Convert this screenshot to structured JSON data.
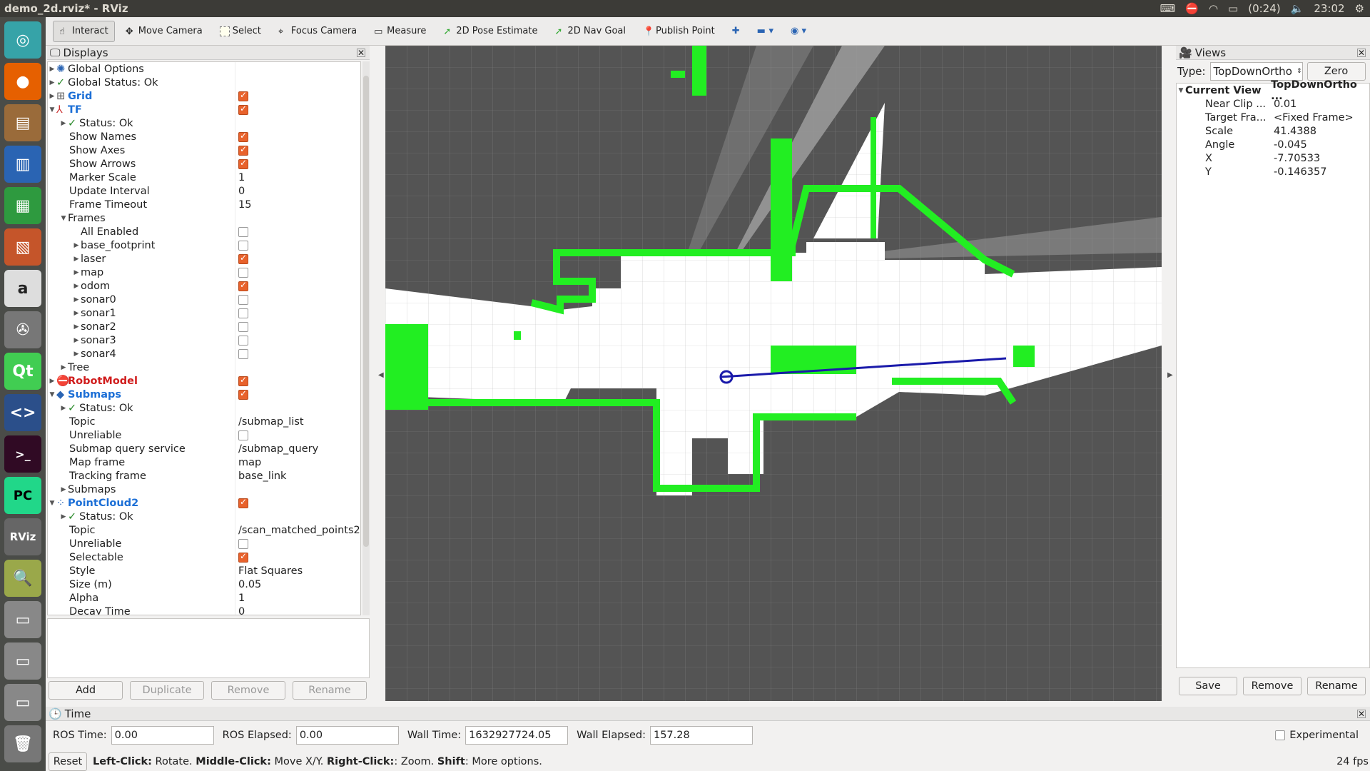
{
  "window": {
    "title": "demo_2d.rviz* - RViz",
    "battery": "(0:24)",
    "clock": "23:02"
  },
  "toolbar": {
    "interact": "Interact",
    "move_camera": "Move Camera",
    "select": "Select",
    "focus_camera": "Focus Camera",
    "measure": "Measure",
    "pose_estimate": "2D Pose Estimate",
    "nav_goal": "2D Nav Goal",
    "publish_point": "Publish Point"
  },
  "displays": {
    "title": "Displays",
    "rows": [
      {
        "label": "Global Options",
        "value": ""
      },
      {
        "label": "Global Status: Ok",
        "value": ""
      },
      {
        "label": "Grid",
        "value": ""
      },
      {
        "label": "TF",
        "value": ""
      },
      {
        "label": "Status: Ok",
        "value": ""
      },
      {
        "label": "Show Names",
        "value": ""
      },
      {
        "label": "Show Axes",
        "value": ""
      },
      {
        "label": "Show Arrows",
        "value": ""
      },
      {
        "label": "Marker Scale",
        "value": "1"
      },
      {
        "label": "Update Interval",
        "value": "0"
      },
      {
        "label": "Frame Timeout",
        "value": "15"
      },
      {
        "label": "Frames",
        "value": ""
      },
      {
        "label": "All Enabled",
        "value": ""
      },
      {
        "label": "base_footprint",
        "value": ""
      },
      {
        "label": "laser",
        "value": ""
      },
      {
        "label": "map",
        "value": ""
      },
      {
        "label": "odom",
        "value": ""
      },
      {
        "label": "sonar0",
        "value": ""
      },
      {
        "label": "sonar1",
        "value": ""
      },
      {
        "label": "sonar2",
        "value": ""
      },
      {
        "label": "sonar3",
        "value": ""
      },
      {
        "label": "sonar4",
        "value": ""
      },
      {
        "label": "Tree",
        "value": ""
      },
      {
        "label": "RobotModel",
        "value": ""
      },
      {
        "label": "Submaps",
        "value": ""
      },
      {
        "label": "Status: Ok",
        "value": ""
      },
      {
        "label": "Topic",
        "value": "/submap_list"
      },
      {
        "label": "Unreliable",
        "value": ""
      },
      {
        "label": "Submap query service",
        "value": "/submap_query"
      },
      {
        "label": "Map frame",
        "value": "map"
      },
      {
        "label": "Tracking frame",
        "value": "base_link"
      },
      {
        "label": "Submaps",
        "value": ""
      },
      {
        "label": "PointCloud2",
        "value": ""
      },
      {
        "label": "Status: Ok",
        "value": ""
      },
      {
        "label": "Topic",
        "value": "/scan_matched_points2"
      },
      {
        "label": "Unreliable",
        "value": ""
      },
      {
        "label": "Selectable",
        "value": ""
      },
      {
        "label": "Style",
        "value": "Flat Squares"
      },
      {
        "label": "Size (m)",
        "value": "0.05"
      },
      {
        "label": "Alpha",
        "value": "1"
      },
      {
        "label": "Decay Time",
        "value": "0"
      }
    ],
    "buttons": {
      "add": "Add",
      "duplicate": "Duplicate",
      "remove": "Remove",
      "rename": "Rename"
    }
  },
  "views": {
    "title": "Views",
    "type_label": "Type:",
    "type_value": "TopDownOrtho",
    "zero": "Zero",
    "current_view": "Current View",
    "current_view_type": "TopDownOrtho ...",
    "props": [
      {
        "label": "Near Clip ...",
        "value": "0.01"
      },
      {
        "label": "Target Fra...",
        "value": "<Fixed Frame>"
      },
      {
        "label": "Scale",
        "value": "41.4388"
      },
      {
        "label": "Angle",
        "value": "-0.045"
      },
      {
        "label": "X",
        "value": "-7.70533"
      },
      {
        "label": "Y",
        "value": "-0.146357"
      }
    ],
    "buttons": {
      "save": "Save",
      "remove": "Remove",
      "rename": "Rename"
    }
  },
  "time": {
    "title": "Time",
    "ros_time_label": "ROS Time:",
    "ros_time": "0.00",
    "ros_elapsed_label": "ROS Elapsed:",
    "ros_elapsed": "0.00",
    "wall_time_label": "Wall Time:",
    "wall_time": "1632927724.05",
    "wall_elapsed_label": "Wall Elapsed:",
    "wall_elapsed": "157.28",
    "experimental": "Experimental"
  },
  "status": {
    "reset": "Reset",
    "hint_b1": "Left-Click:",
    "hint_t1": " Rotate. ",
    "hint_b2": "Middle-Click:",
    "hint_t2": " Move X/Y. ",
    "hint_b3": "Right-Click:",
    "hint_t3": ": Zoom. ",
    "hint_b4": "Shift",
    "hint_t4": ": More options.",
    "fps": "24 fps"
  },
  "launcher": [
    "ubuntu-icon",
    "firefox-icon",
    "files-icon",
    "writer-icon",
    "calc-icon",
    "impress-icon",
    "amazon-icon",
    "settings-icon",
    "qt-icon",
    "code-icon",
    "terminal-icon",
    "pycharm-icon",
    "rviz-icon",
    "viewer-icon",
    "disk-icon",
    "disk-icon",
    "disk-icon",
    "trash-icon"
  ]
}
